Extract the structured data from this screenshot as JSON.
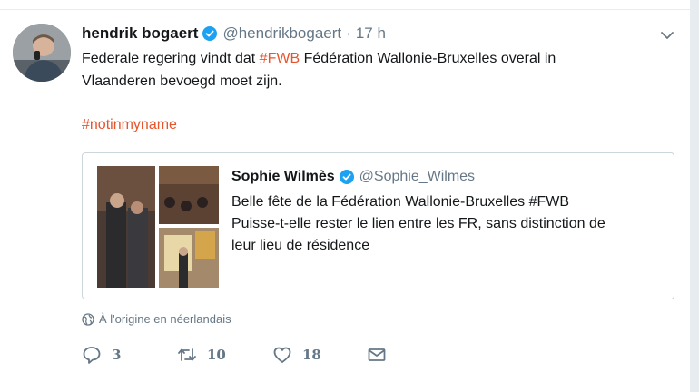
{
  "tweet": {
    "author_name": "hendrik bogaert",
    "author_handle": "@hendrikbogaert",
    "separator": "·",
    "time": "17 h",
    "text_line1_before": "Federale regering vindt dat ",
    "text_hashtag1": "#FWB",
    "text_line1_after": " Fédération Wallonie-Bruxelles overal in",
    "text_line2": "Vlaanderen bevoegd moet zijn.",
    "hashtag2": "#notinmyname"
  },
  "quoted": {
    "author_name": "Sophie Wilmès",
    "author_handle": "@Sophie_Wilmes",
    "lines": [
      "Belle fête de la Fédération Wallonie-Bruxelles #FWB",
      "Puisse-t-elle rester le lien entre les FR, sans distinction de",
      "leur lieu de résidence"
    ]
  },
  "translate_label": "À l'origine en néerlandais",
  "actions": {
    "reply_count": "3",
    "retweet_count": "10",
    "like_count": "18"
  },
  "icons": [
    "verified-badge-icon",
    "chevron-down-icon",
    "globe-icon",
    "reply-icon",
    "retweet-icon",
    "heart-icon",
    "message-icon"
  ],
  "colors": {
    "hashtag": "#e8542c",
    "verified": "#1da1f2",
    "muted": "#657786",
    "border": "#ccd6dd"
  }
}
